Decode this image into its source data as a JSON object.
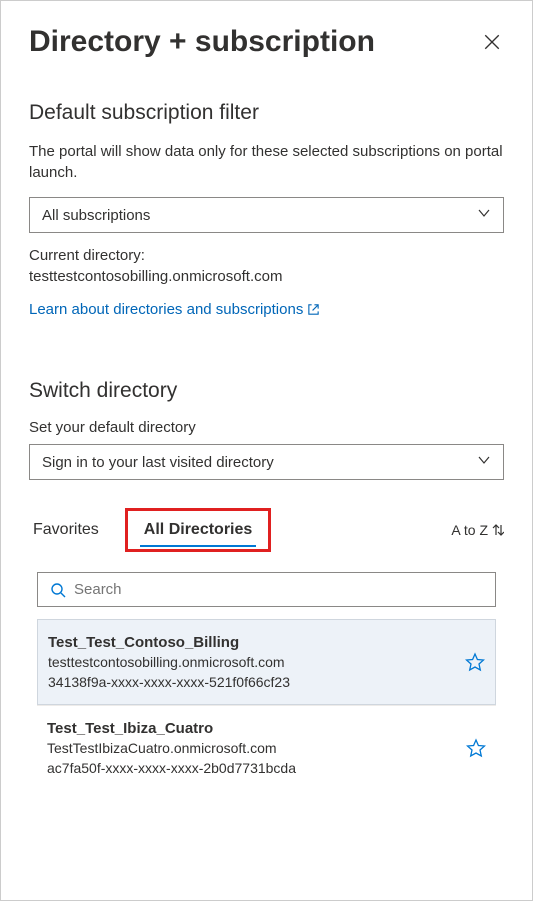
{
  "header": {
    "title": "Directory + subscription"
  },
  "subscription_filter": {
    "heading": "Default subscription filter",
    "description": "The portal will show data only for these selected subscriptions on portal launch.",
    "dropdown_value": "All subscriptions",
    "current_directory_label": "Current directory:",
    "current_directory_value": "testtestcontosobilling.onmicrosoft.com",
    "learn_link": "Learn about directories and subscriptions"
  },
  "switch_directory": {
    "heading": "Switch directory",
    "label": "Set your default directory",
    "dropdown_value": "Sign in to your last visited directory"
  },
  "tabs": {
    "favorites": "Favorites",
    "all_directories": "All Directories",
    "sort": "A to Z"
  },
  "search": {
    "placeholder": "Search"
  },
  "directories": [
    {
      "name": "Test_Test_Contoso_Billing",
      "domain": "testtestcontosobilling.onmicrosoft.com",
      "id": "34138f9a-xxxx-xxxx-xxxx-521f0f66cf23",
      "selected": true
    },
    {
      "name": "Test_Test_Ibiza_Cuatro",
      "domain": "TestTestIbizaCuatro.onmicrosoft.com",
      "id": "ac7fa50f-xxxx-xxxx-xxxx-2b0d7731bcda",
      "selected": false
    }
  ]
}
